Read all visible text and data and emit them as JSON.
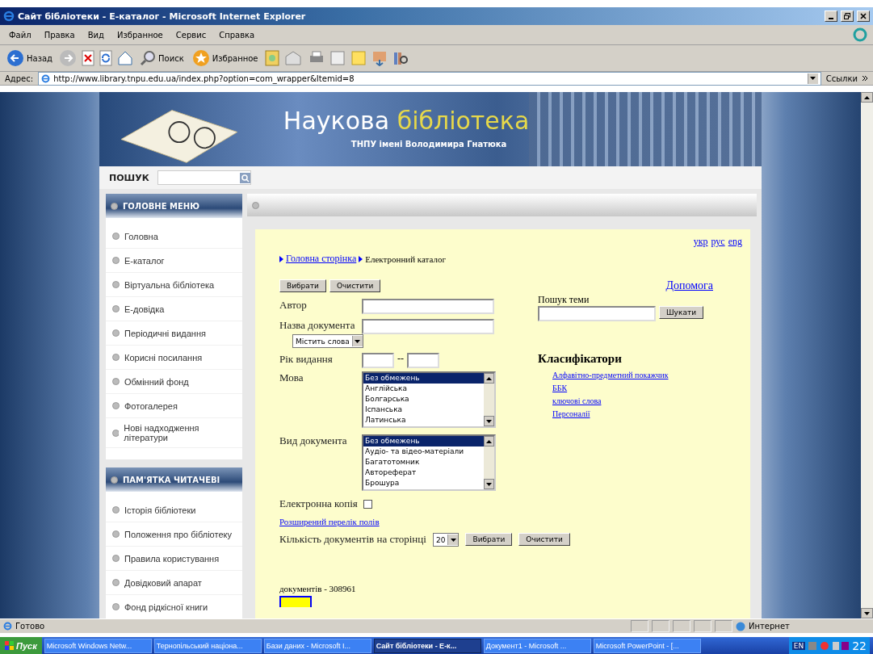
{
  "window": {
    "title": "Сайт бібліотеки - Е-каталог - Microsoft Internet Explorer"
  },
  "menu": [
    "Файл",
    "Правка",
    "Вид",
    "Избранное",
    "Сервис",
    "Справка"
  ],
  "toolbar": {
    "back": "Назад",
    "search": "Поиск",
    "favorites": "Избранное"
  },
  "address": {
    "label": "Адрес:",
    "url": "http://www.library.tnpu.edu.ua/index.php?option=com_wrapper&Itemid=8",
    "links": "Ссылки"
  },
  "site": {
    "title_main": "Наукова",
    "title_accent": "бібліотека",
    "subtitle": "ТНПУ імені Володимира Гнатюка",
    "search_label": "ПОШУК"
  },
  "menus": [
    {
      "title": "ГОЛОВНЕ МЕНЮ",
      "items": [
        "Головна",
        "Е-каталог",
        "Віртуальна бібліотека",
        "Е-довідка",
        "Періодичні видання",
        "Корисні посилання",
        "Обмінний фонд",
        "Фотогалерея",
        "Нові надходження літератури"
      ]
    },
    {
      "title": "ПАМ'ЯТКА ЧИТАЧЕВІ",
      "items": [
        "Історія бібліотеки",
        "Положення про бібліотеку",
        "Правила користування",
        "Довідковий апарат",
        "Фонд рідкісної книги"
      ]
    }
  ],
  "catalog": {
    "languages": [
      "укр",
      "рус",
      "eng"
    ],
    "breadcrumb": {
      "link": "Головна сторінка",
      "current": "Електронний каталог"
    },
    "buttons": [
      "Вибрати",
      "Очистити"
    ],
    "help": "Допомога",
    "author_label": "Автор",
    "title_label": "Назва документа",
    "title_mode": "Містить слова",
    "year_label": "Рік видання",
    "year_sep": "--",
    "language_label": "Мова",
    "language_options": [
      {
        "label": "Без обмежень",
        "selected": true
      },
      {
        "label": "Англійська",
        "selected": false
      },
      {
        "label": "Болгарська",
        "selected": false
      },
      {
        "label": "Іспанська",
        "selected": false
      },
      {
        "label": "Латинська",
        "selected": false
      }
    ],
    "doctype_label": "Вид документа",
    "doctype_options": [
      {
        "label": "Без обмежень",
        "selected": true
      },
      {
        "label": "Аудіо- та відео-матеріали",
        "selected": false
      },
      {
        "label": "Багатотомник",
        "selected": false
      },
      {
        "label": "Автореферат",
        "selected": false
      },
      {
        "label": "Брошура",
        "selected": false
      }
    ],
    "ecopy_label": "Електронна копія",
    "ecopy_checked": false,
    "extended_link": "Розширений перелік полів",
    "per_page_label": "Кількість документів на сторінці",
    "per_page": "20",
    "bottom_buttons": [
      "Вибрати",
      "Очистити"
    ],
    "count": "документів - 308961",
    "topic_label": "Пошук теми",
    "topic_button": "Шукати",
    "classifiers_title": "Класифікатори",
    "classifiers": [
      "Алфавітно-предметний покажчик",
      "ББК",
      "ключові слова",
      "Персоналії"
    ]
  },
  "status_bar": {
    "text": "Готово",
    "zone": "Интернет"
  },
  "taskbar": {
    "start": "Пуск",
    "tasks": [
      {
        "label": "Microsoft Windows Netw...",
        "selected": false
      },
      {
        "label": "Тернопільський націона...",
        "selected": false
      },
      {
        "label": "Бази даних - Microsoft I...",
        "selected": false
      },
      {
        "label": "Сайт бібліотеки - Е-к...",
        "selected": true
      },
      {
        "label": "Документ1 - Microsoft ...",
        "selected": false
      },
      {
        "label": "Microsoft PowerPoint - [...",
        "selected": false
      }
    ],
    "lang": "EN",
    "time": "22"
  }
}
